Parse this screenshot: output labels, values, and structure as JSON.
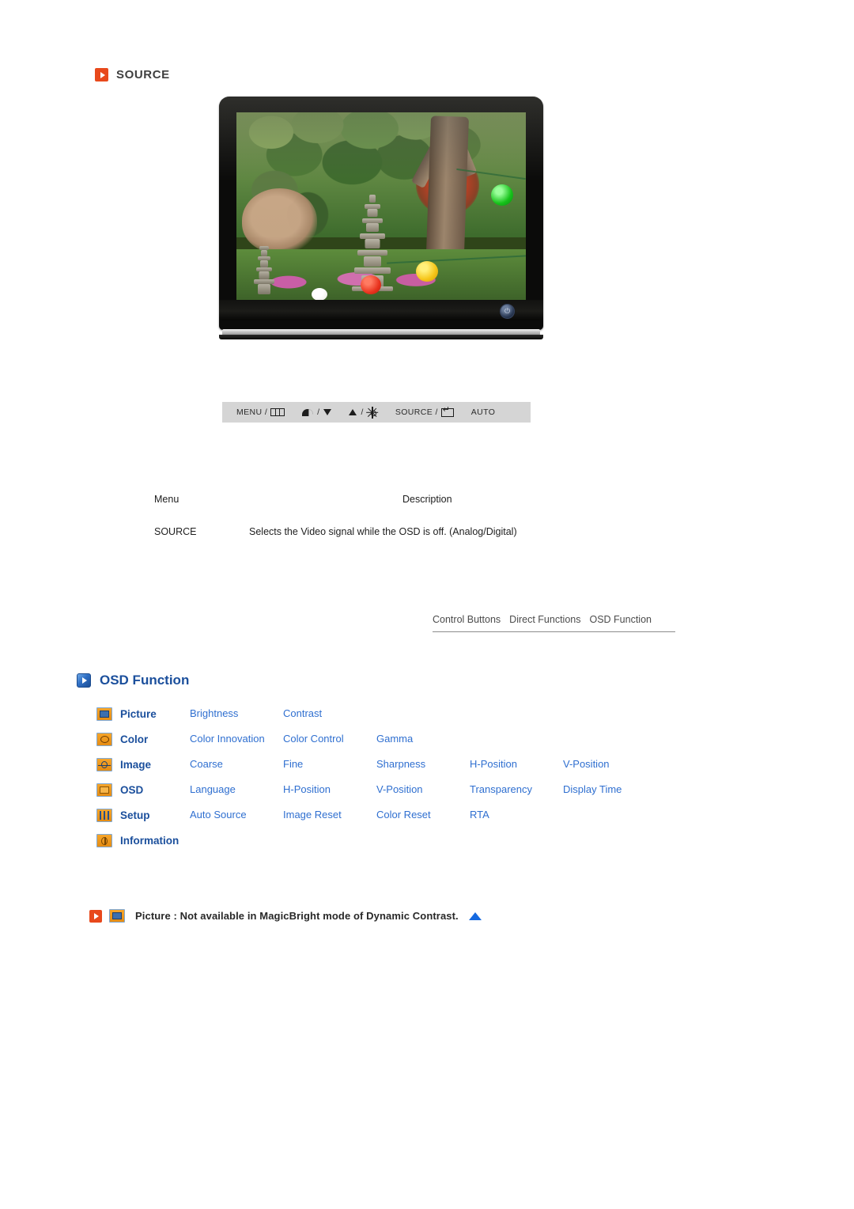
{
  "source_section": {
    "heading": "SOURCE",
    "icon": "red-arrow-icon"
  },
  "monitor": {
    "power_glyph": "⏻",
    "screen_alt": "garden photo with stone pagoda, trees and paper lanterns"
  },
  "control_buttons": [
    {
      "label": "MENU /",
      "icon": "menu-grid-icon"
    },
    {
      "label": "/",
      "icon_left": "contrast-icon",
      "icon_right": "down-arrow-icon"
    },
    {
      "label": "/",
      "icon_left": "up-arrow-icon",
      "icon_right": "brightness-sun-icon"
    },
    {
      "label": "SOURCE /",
      "icon": "enter-key-icon"
    },
    {
      "label": "AUTO"
    }
  ],
  "desc_table": {
    "headers": {
      "menu": "Menu",
      "description": "Description"
    },
    "rows": [
      {
        "menu": "SOURCE",
        "description": "Selects the Video signal while the OSD is off. (Analog/Digital)"
      }
    ]
  },
  "tabs": [
    {
      "label": "Control Buttons"
    },
    {
      "label": "Direct Functions"
    },
    {
      "label": "OSD Function"
    }
  ],
  "osd_function": {
    "heading": "OSD Function",
    "icon": "blue-arrow-icon",
    "rows": [
      {
        "icon": "picture-icon",
        "category": "Picture",
        "items": [
          "Brightness",
          "Contrast",
          "",
          "",
          ""
        ]
      },
      {
        "icon": "color-icon",
        "category": "Color",
        "items": [
          "Color Innovation",
          "Color Control",
          "Gamma",
          "",
          ""
        ]
      },
      {
        "icon": "image-icon",
        "category": "Image",
        "items": [
          "Coarse",
          "Fine",
          "Sharpness",
          "H-Position",
          "V-Position"
        ]
      },
      {
        "icon": "osd-icon",
        "category": "OSD",
        "items": [
          "Language",
          "H-Position",
          "V-Position",
          "Transparency",
          "Display Time"
        ]
      },
      {
        "icon": "setup-icon",
        "category": "Setup",
        "items": [
          "Auto Source",
          "Image Reset",
          "Color Reset",
          "RTA",
          ""
        ]
      },
      {
        "icon": "information-icon",
        "category": "Information",
        "items": [
          "",
          "",
          "",
          "",
          ""
        ]
      }
    ]
  },
  "note": {
    "text": "Picture : Not available in MagicBright mode of Dynamic Contrast.",
    "lead_icon": "red-arrow-icon",
    "category_icon": "picture-icon",
    "back_to_top_icon": "blue-up-triangle-icon"
  },
  "colors": {
    "red_accent": "#e8491c",
    "blue_heading": "#1b4f9c",
    "blue_link": "#2f6fd0",
    "icon_orange": "#f0941a",
    "strip_gray": "#d5d5d5"
  }
}
